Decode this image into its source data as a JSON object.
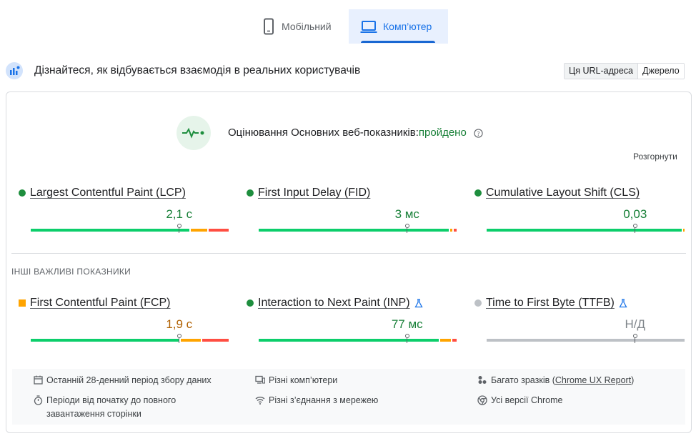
{
  "tabs": [
    {
      "label": "Мобільний",
      "active": false
    },
    {
      "label": "Комп’ютер",
      "active": true
    }
  ],
  "header": {
    "discover_text": "Дізнайтеся, як відбувається взаємодія в реальних користувачів",
    "segment": {
      "url_label": "Ця URL-адреса",
      "origin_label": "Джерело",
      "selected": "Ця URL-адреса"
    }
  },
  "assessment": {
    "label": "Оцінювання Основних веб-показників:",
    "result": "пройдено",
    "expand_label": "Розгорнути"
  },
  "core_metrics": [
    {
      "name": "Largest Contentful Paint (LCP)",
      "value": "2,1 с",
      "status": "good",
      "position": 0.75,
      "distribution": [
        0.8,
        0.09,
        0.11
      ]
    },
    {
      "name": "First Input Delay (FID)",
      "value": "3 мс",
      "status": "good",
      "position": 0.75,
      "distribution": [
        0.96,
        0.02,
        0.02
      ]
    },
    {
      "name": "Cumulative Layout Shift (CLS)",
      "value": "0,03",
      "status": "good",
      "position": 0.75,
      "distribution": [
        0.985,
        0.015,
        0.0
      ]
    }
  ],
  "other_title": "ІНШІ ВАЖЛИВІ ПОКАЗНИКИ",
  "other_metrics": [
    {
      "name": "First Contentful Paint (FCP)",
      "value": "1,9 с",
      "status": "average",
      "experimental": false,
      "position": 0.75,
      "distribution": [
        0.75,
        0.11,
        0.14
      ]
    },
    {
      "name": "Interaction to Next Paint (INP)",
      "value": "77 мс",
      "status": "good",
      "experimental": true,
      "position": 0.75,
      "distribution": [
        0.91,
        0.06,
        0.03
      ]
    },
    {
      "name": "Time to First Byte (TTFB)",
      "value": "Н/Д",
      "status": "none",
      "experimental": true,
      "position": 0.75,
      "distribution": [
        1.0,
        0.0,
        0.0
      ]
    }
  ],
  "footer": {
    "period": "Останній 28-денний період збору даних",
    "devices": "Різні комп’ютери",
    "samples_prefix": "Багато зразків (",
    "samples_link": "Chrome UX Report",
    "samples_suffix": ")",
    "load": "Періоди від початку до повного завантаження сторінки",
    "network": "Різні з’єднання з мережею",
    "chrome": "Усі версії Chrome"
  },
  "colors": {
    "good": "#1e8e3e",
    "good_bar": "#0cce6b",
    "average": "#e8710a",
    "average_bar": "#ffa400",
    "poor_bar": "#ff4e42",
    "na": "#bdc1c6",
    "value_good": "#188038",
    "value_avg": "#b06000",
    "value_na": "#80868b",
    "accent": "#1a73e8"
  }
}
